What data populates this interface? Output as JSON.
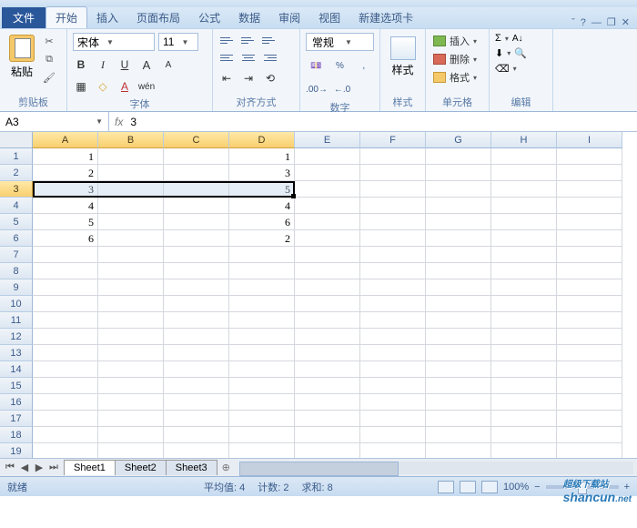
{
  "tabs": {
    "file": "文件",
    "home": "开始",
    "insert": "插入",
    "layout": "页面布局",
    "formulas": "公式",
    "data": "数据",
    "review": "审阅",
    "view": "视图",
    "newtab": "新建选项卡"
  },
  "ribbon": {
    "clipboard": {
      "label": "剪贴板",
      "paste": "粘贴"
    },
    "font": {
      "label": "字体",
      "name": "宋体",
      "size": "11",
      "bold": "B",
      "italic": "I",
      "underline": "U",
      "grow": "A",
      "shrink": "A"
    },
    "align": {
      "label": "对齐方式"
    },
    "number": {
      "label": "数字",
      "format": "常规"
    },
    "styles": {
      "label": "样式",
      "btn": "样式"
    },
    "cells": {
      "label": "单元格",
      "insert": "插入",
      "delete": "删除",
      "format": "格式"
    },
    "editing": {
      "label": "编辑",
      "sigma": "Σ"
    }
  },
  "namebox": {
    "ref": "A3",
    "fx": "fx",
    "value": "3"
  },
  "columns": [
    "A",
    "B",
    "C",
    "D",
    "E",
    "F",
    "G",
    "H",
    "I"
  ],
  "selected_cols": [
    "A",
    "B",
    "C",
    "D"
  ],
  "rows": [
    1,
    2,
    3,
    4,
    5,
    6,
    7,
    8,
    9,
    10,
    11,
    12,
    13,
    14,
    15,
    16,
    17,
    18,
    19
  ],
  "selected_row": 3,
  "cellsA": {
    "1": "1",
    "2": "2",
    "3": "3",
    "4": "4",
    "5": "5",
    "6": "6"
  },
  "cellsD": {
    "1": "1",
    "2": "3",
    "3": "5",
    "4": "4",
    "5": "6",
    "6": "2"
  },
  "sheets": {
    "s1": "Sheet1",
    "s2": "Sheet2",
    "s3": "Sheet3"
  },
  "status": {
    "ready": "就绪",
    "avg": "平均值: 4",
    "count": "计数: 2",
    "sum": "求和: 8",
    "zoom": "100%",
    "minus": "−",
    "plus": "+"
  },
  "watermark": {
    "main": "shancun",
    "sub": "超级下载站",
    "dot": ".net"
  },
  "chart_data": {
    "type": "table",
    "columns": [
      "A",
      "D"
    ],
    "rows": [
      {
        "A": 1,
        "D": 1
      },
      {
        "A": 2,
        "D": 3
      },
      {
        "A": 3,
        "D": 5
      },
      {
        "A": 4,
        "D": 4
      },
      {
        "A": 5,
        "D": 6
      },
      {
        "A": 6,
        "D": 2
      }
    ]
  }
}
